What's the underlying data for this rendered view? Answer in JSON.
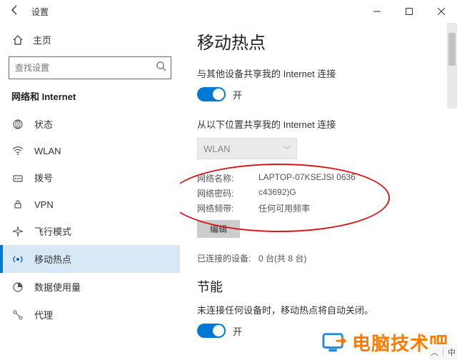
{
  "window": {
    "title": "设置"
  },
  "sidebar": {
    "home": "主页",
    "search_placeholder": "查找设置",
    "section": "网络和 Internet",
    "items": [
      {
        "icon": "status-icon",
        "label": "状态"
      },
      {
        "icon": "wifi-icon",
        "label": "WLAN"
      },
      {
        "icon": "dialup-icon",
        "label": "拨号"
      },
      {
        "icon": "vpn-icon",
        "label": "VPN"
      },
      {
        "icon": "airplane-icon",
        "label": "飞行模式"
      },
      {
        "icon": "hotspot-icon",
        "label": "移动热点"
      },
      {
        "icon": "data-usage-icon",
        "label": "数据使用量"
      },
      {
        "icon": "proxy-icon",
        "label": "代理"
      }
    ]
  },
  "main": {
    "heading": "移动热点",
    "share_label": "与其他设备共享我的 Internet 连接",
    "share_toggle_state": "开",
    "share_from_label": "从以下位置共享我的 Internet 连接",
    "share_from_value": "WLAN",
    "network": {
      "name_label": "网络名称:",
      "name_value": "LAPTOP-07KSEJSI 0636",
      "pwd_label": "网络密码:",
      "pwd_value": "c43692)G",
      "band_label": "网络频带:",
      "band_value": "任何可用频率",
      "edit": "编辑"
    },
    "connected": {
      "label": "已连接的设备:",
      "value": "0 台(共 8 台)"
    },
    "power": {
      "heading": "节能",
      "desc": "未连接任何设备时，移动热点将自动关闭。",
      "toggle_state": "开"
    }
  },
  "logo_text": "电脑技术吧",
  "tray": {
    "ime": "中"
  }
}
